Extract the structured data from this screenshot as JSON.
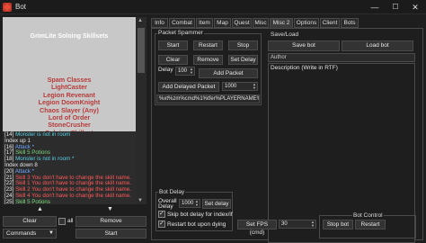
{
  "window": {
    "title": "Bot",
    "minimize": "—",
    "maximize": "☐",
    "close": "✕"
  },
  "log": {
    "title": "GrimLite Soloing Skillsets",
    "spam": [
      "Spam Classes",
      "LightCaster",
      "Legion Revenant",
      "Legion DoomKnight",
      "Chaos Slayer (Any)",
      "Lord of Order",
      "StoneCrusher",
      "Soloing Skillset"
    ],
    "lines": [
      {
        "idx": "[14]",
        "cmd": "Monster is not in room",
        "color": "c-cyan"
      },
      {
        "idx": "",
        "cmd": "Index up  1",
        "color": "c-white"
      },
      {
        "idx": "[16]",
        "cmd": "Attack  *",
        "color": "c-blue"
      },
      {
        "idx": "[17]",
        "cmd": "Skill 5  Potions",
        "color": "c-green"
      },
      {
        "idx": "[18]",
        "cmd": "Monster is not in room  *",
        "color": "c-cyan"
      },
      {
        "idx": "",
        "cmd": "Index down  8",
        "color": "c-white"
      },
      {
        "idx": "[20]",
        "cmd": "Attack  *",
        "color": "c-blue"
      },
      {
        "idx": "[21]",
        "cmd": "Skill 3  You don't have to change the skill name.",
        "color": "c-red"
      },
      {
        "idx": "[22]",
        "cmd": "Skill 1  You don't have to change the skill name.",
        "color": "c-red"
      },
      {
        "idx": "[23]",
        "cmd": "Skill 2  You don't have to change the skill name.",
        "color": "c-red"
      },
      {
        "idx": "[24]",
        "cmd": "Skill 4  You don't have to change the skill name.",
        "color": "c-red"
      },
      {
        "idx": "[25]",
        "cmd": "Skill 5  Potions",
        "color": "c-green"
      }
    ]
  },
  "left_controls": {
    "up_arrow": "▲",
    "down_arrow": "▼",
    "clear": "Clear",
    "all_label": "all",
    "remove": "Remove",
    "commands_select": "Commands",
    "start": "Start"
  },
  "tabs": [
    "Info",
    "Combat",
    "Item",
    "Map",
    "Quest",
    "Misc",
    "Misc 2",
    "Options",
    "Client",
    "Bots"
  ],
  "active_tab": "Misc 2",
  "packet_spammer": {
    "label": "Packet Spammer",
    "start": "Start",
    "restart": "Restart",
    "stop": "Stop",
    "clear": "Clear",
    "remove": "Remove",
    "set_delay": "Set Delay",
    "delay_label": "Delay",
    "delay_value": "100",
    "add_packet": "Add Packet",
    "add_delayed": "Add Delayed Packet",
    "delayed_value": "1000",
    "packet_text": "%xt%zm%cmd%1%tfer%PLAYERNAME%M"
  },
  "save_load": {
    "label": "Save/Load",
    "save_bot": "Save bot",
    "load_bot": "Load bot",
    "author_placeholder": "Author",
    "description_label": "Description (Write in RTF)"
  },
  "bot_delay": {
    "label": "Bot Delay",
    "overall_label": "Overall",
    "delay_label": "Delay",
    "overall_value": "1000",
    "set_delay": "Set delay",
    "skip_label": "Skip bot delay for index/if",
    "restart_label": "Restart bot upon dying"
  },
  "fps": {
    "set_fps": "Set FPS (cmd)",
    "value": "30"
  },
  "bot_control": {
    "label": "Bot Control",
    "stop_bot": "Stop bot",
    "restart": "Restart"
  }
}
